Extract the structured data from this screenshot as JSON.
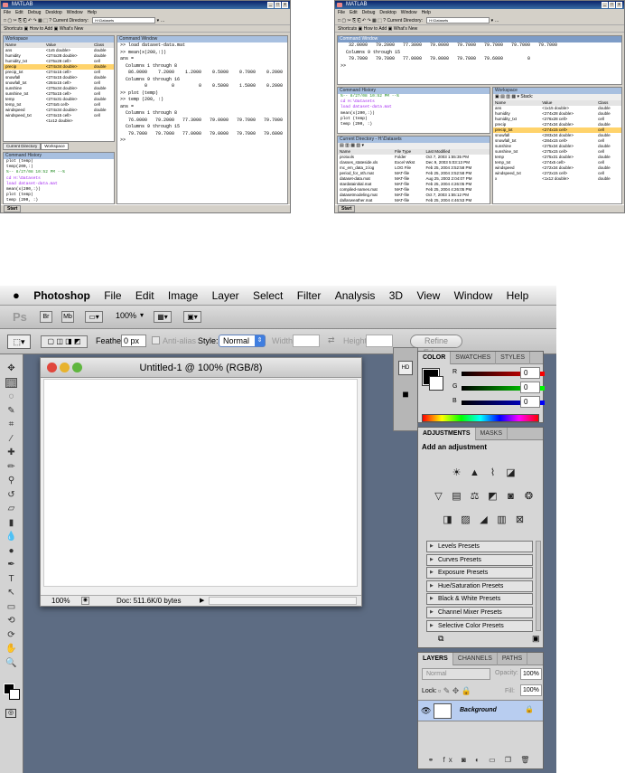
{
  "matlab_left": {
    "title": "MATLAB",
    "menu": [
      "File",
      "Edit",
      "Debug",
      "Desktop",
      "Window",
      "Help"
    ],
    "toolbar_label": "Current Directory:",
    "current_dir": "H:\\Datasets",
    "shortcuts": [
      "Shortcuts",
      "How to Add",
      "What's New"
    ],
    "workspace_title": "Workspace",
    "workspace_headers": [
      "Name",
      "Value",
      "Class"
    ],
    "workspace_rows": [
      [
        "ans",
        "<1x5 double>",
        "double"
      ],
      [
        "humidity",
        "<274x28 double>",
        "double"
      ],
      [
        "humidity_txt",
        "<275x28 cell>",
        "cell"
      ],
      [
        "precip",
        "<274x34 double>",
        "double"
      ],
      [
        "precip_txt",
        "<274x15 cell>",
        "cell"
      ],
      [
        "snowfall",
        "<274x15 double>",
        "double"
      ],
      [
        "snowfall_txt",
        "<284x15 cell>",
        "cell"
      ],
      [
        "sunshine",
        "<275x34 double>",
        "double"
      ],
      [
        "sunshine_txt",
        "<275x15 cell>",
        "cell"
      ],
      [
        "temp",
        "<274x31 double>",
        "double"
      ],
      [
        "temp_txt",
        "<274x5 cell>",
        "cell"
      ],
      [
        "windspeed",
        "<274x34 double>",
        "double"
      ],
      [
        "windspeed_txt",
        "<274x15 cell>",
        "cell"
      ],
      [
        "",
        "<1x12 double>",
        ""
      ]
    ],
    "tabs": [
      "Current Directory",
      "Workspace"
    ],
    "history_title": "Command History",
    "history_lines": [
      "plot (temp)",
      "temp(200,:)",
      "%-- 8/27/08 10:52 PM --%",
      "cd H:\\Datasets",
      "load dataset-data.mat",
      "mean(x(200,:))",
      "plot (temp)",
      "temp (200, :)"
    ],
    "cmd_title": "Command Window",
    "cmd_lines": [
      ">> load dataset-data.mat",
      ">> mean(x(200,:))",
      "",
      "ans =",
      "",
      "  Columns 1 through 8",
      "",
      "   86.0000    7.2000    1.2000    0.5000    0.7000    0.2000         0         0",
      "",
      "  Columns 9 through 16",
      "",
      "         0         0         0    0.5000    1.5000    0.2000",
      "",
      ">> plot (temp)",
      ">> temp (200, :)",
      "",
      "ans =",
      "",
      "  Columns 1 through 8",
      "",
      "   76.0000   79.2000   77.3000   79.0000   79.7000   79.7000   79.7000   79.7000",
      "",
      "  Columns 9 through 15",
      "",
      "   79.7000   79.7000   77.0000   79.0000   79.7000   79.6000   79.0000",
      "",
      ">>"
    ],
    "start": "Start"
  },
  "matlab_right": {
    "title": "MATLAB",
    "menu": [
      "File",
      "Edit",
      "Debug",
      "Desktop",
      "Window",
      "Help"
    ],
    "toolbar_label": "Current Directory:",
    "current_dir": "H:\\Datasets",
    "shortcuts": [
      "Shortcuts",
      "How to Add",
      "What's New"
    ],
    "cmd_title": "Command Window",
    "cmd_lines": [
      "   32.0000   79.2000   77.3000   79.0000   79.7000   79.7000   79.7000   79.7000",
      "",
      "  Columns 9 through 15",
      "",
      "   79.7000   79.7000   77.0000   79.0000   79.7000   79.6000         0",
      "",
      ">>"
    ],
    "history_title": "Command History",
    "history_lines": [
      "%-- 8/27/08 10:52 PM --%",
      "cd H:\\Datasets",
      "load dataset-data.mat",
      "mean(x(200,:))",
      "plot (temp)",
      "temp (200, :)"
    ],
    "dir_title": "Current Directory - H:\\Datasets",
    "dir_headers": [
      "Name",
      "File Type",
      "Last Modified"
    ],
    "dir_rows": [
      [
        "protools",
        "Folder",
        "Oct 7, 2003 1:55:35 PM"
      ],
      [
        "classes_stateside.xls",
        "Excel Wkst",
        "Dec 9, 2003 5:03:13 PM"
      ],
      [
        "mc_em_data_2.log",
        "LOG File",
        "Feb 25, 2004 3:52:58 PM"
      ],
      [
        "period_for_nth.mat",
        "MAT-file",
        "Feb 25, 2004 3:52:58 PM"
      ],
      [
        "dataset-data.mat",
        "MAT-file",
        "Aug 25, 2003 2:04:07 PM"
      ],
      [
        "stardatainitial.mat",
        "MAT-file",
        "Feb 25, 2004 4:26:05 PM"
      ],
      [
        "compiled-names.mat",
        "MAT-file",
        "Feb 25, 2004 4:26:05 PM"
      ],
      [
        "datasetmodeling.mat",
        "MAT-file",
        "Oct 7, 2003 1:55:12 PM"
      ],
      [
        "dallasweather.mat",
        "MAT-file",
        "Feb 25, 2004 4:46:53 PM"
      ]
    ],
    "workspace_title": "Workspace",
    "stack_label": "Stack:",
    "workspace_headers": [
      "Name",
      "Value",
      "Class"
    ],
    "workspace_rows": [
      [
        "ans",
        "<1x15 double>",
        "double"
      ],
      [
        "humidity",
        "<274x28 double>",
        "double"
      ],
      [
        "humidity_txt",
        "<276x28 cell>",
        "cell"
      ],
      [
        "precip",
        "<274x34 double>",
        "double"
      ],
      [
        "precip_txt",
        "<274x15 cell>",
        "cell"
      ],
      [
        "snowfall",
        "<283x34 double>",
        "double"
      ],
      [
        "snowfall_txt",
        "<284x15 cell>",
        "cell"
      ],
      [
        "sunshine",
        "<275x34 double>",
        "double"
      ],
      [
        "sunshine_txt",
        "<275x15 cell>",
        "cell"
      ],
      [
        "temp",
        "<275x31 double>",
        "double"
      ],
      [
        "temp_txt",
        "<274x5 cell>",
        "cell"
      ],
      [
        "windspeed",
        "<272x34 double>",
        "double"
      ],
      [
        "windspeed_txt",
        "<272x15 cell>",
        "cell"
      ],
      [
        "x",
        "<1x12 double>",
        "double"
      ]
    ],
    "start": "Start"
  },
  "photoshop": {
    "menu": [
      "Photoshop",
      "File",
      "Edit",
      "Image",
      "Layer",
      "Select",
      "Filter",
      "Analysis",
      "3D",
      "View",
      "Window",
      "Help"
    ],
    "zoom": "100%",
    "options": {
      "feather_label": "Feather:",
      "feather_value": "0 px",
      "antialias_label": "Anti-alias",
      "style_label": "Style:",
      "style_value": "Normal",
      "width_label": "Width:",
      "height_label": "Height:",
      "refine_label": "Refine Edge..."
    },
    "doc": {
      "title": "Untitled-1 @ 100% (RGB/8)",
      "zoom": "100%",
      "status": "Doc: 511.6K/0 bytes"
    },
    "color_panel": {
      "tabs": [
        "COLOR",
        "SWATCHES",
        "STYLES"
      ],
      "channels": [
        "R",
        "G",
        "B"
      ],
      "values": [
        "0",
        "0",
        "0"
      ]
    },
    "adjustments": {
      "tabs": [
        "ADJUSTMENTS",
        "MASKS"
      ],
      "heading": "Add an adjustment",
      "presets": [
        "Levels Presets",
        "Curves Presets",
        "Exposure Presets",
        "Hue/Saturation Presets",
        "Black & White Presets",
        "Channel Mixer Presets",
        "Selective Color Presets"
      ]
    },
    "layers": {
      "tabs": [
        "LAYERS",
        "CHANNELS",
        "PATHS"
      ],
      "blend": "Normal",
      "opacity_label": "Opacity:",
      "opacity": "100%",
      "lock_label": "Lock:",
      "fill_label": "Fill:",
      "fill": "100%",
      "layer_name": "Background"
    }
  }
}
